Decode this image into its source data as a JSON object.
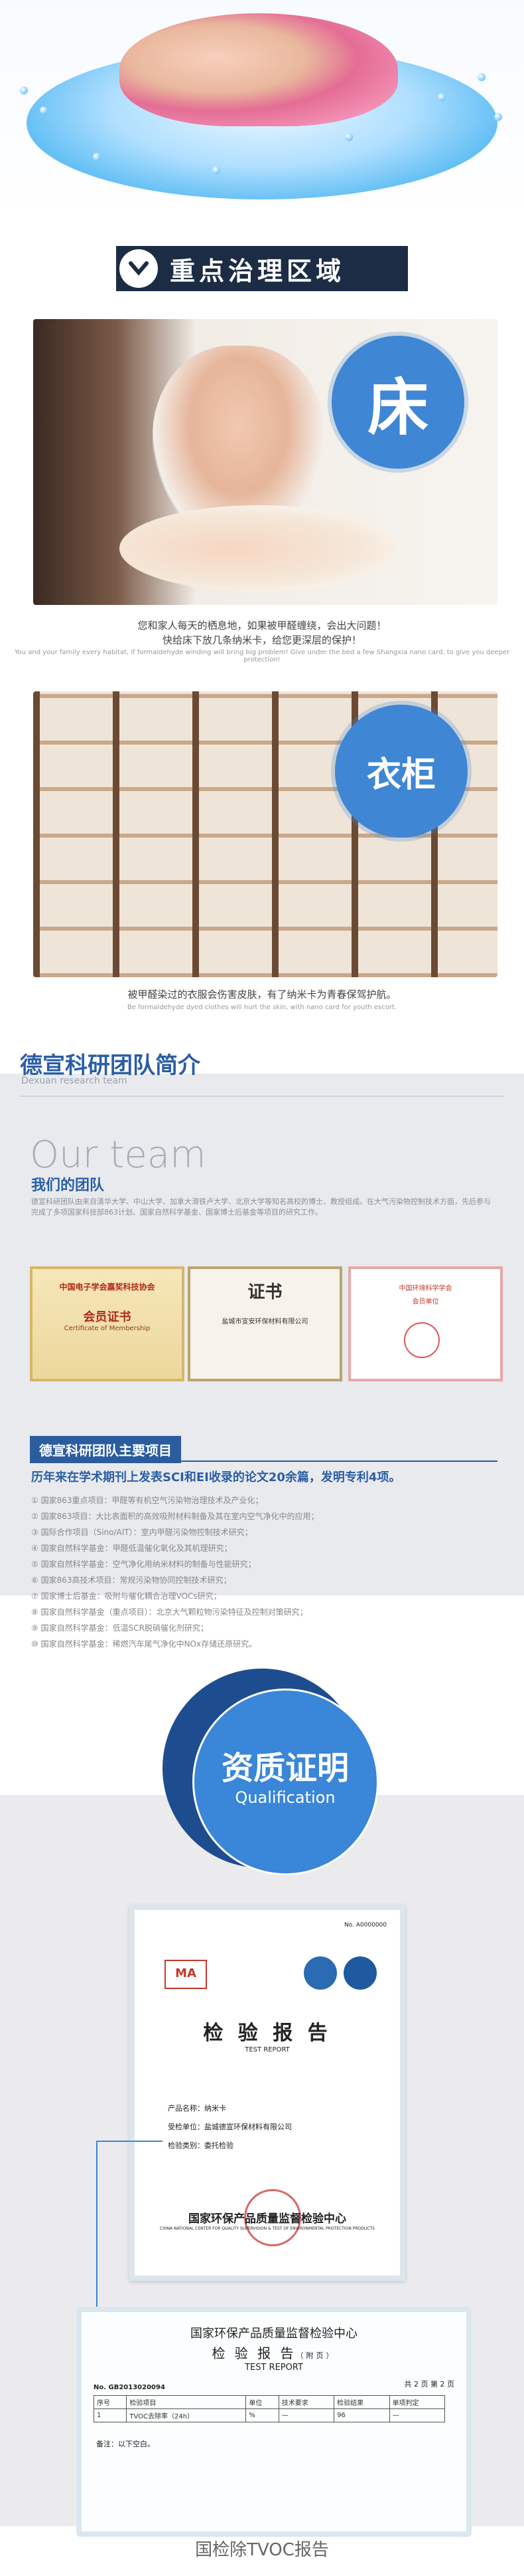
{
  "section_title": "重点治理区域",
  "bed": {
    "badge": "床",
    "caption": "您和家人每天的栖息地，如果被甲醛缠绕，会出大问题！",
    "caption2": "快给床下放几条纳米卡，给您更深层的保护！",
    "caption_en": "You and your family every habitat, if formaldehyde winding will bring big problem! Give under the bed a few Shangxia nano card, to give you deeper protection!"
  },
  "closet": {
    "badge": "衣柜",
    "caption": "被甲醛染过的衣服会伤害皮肤，有了纳米卡为青春保驾护航。",
    "caption_en": "Be formaldehyde dyed clothes will hurt the skin, with nano card for youth escort."
  },
  "team": {
    "heading": "德宣科研团队简介",
    "heading_en": "Dexuan research team",
    "our_team": "Our team",
    "our_team_cn": "我们的团队",
    "intro": "德宣科研团队由来自清华大学、中山大学、加拿大滑铁卢大学、北京大学等知名高校的博士、教授组成。在大气污染物控制技术方面，先后参与完成了多项国家科技部863计划、国家自然科学基金、国家博士后基金等项目的研究工作。",
    "certs": [
      {
        "title": "中国电子学会嘉奖科技协会",
        "sub": "会员证书",
        "en": "Certificate of Membership"
      },
      {
        "title": "证书",
        "sub": "盐城市宣安环保材料有限公司",
        "en": ""
      },
      {
        "title": "中国环境科学学会",
        "sub": "会员单位",
        "en": ""
      }
    ],
    "projects_title": "德宣科研团队主要项目",
    "projects_sub": "历年来在学术期刊上发表SCI和EI收录的论文20余篇，发明专利4项。",
    "projects": [
      "① 国家863重点项目：甲醛等有机空气污染物治理技术及产业化；",
      "② 国家863项目：大比表面积的高效吸附材料制备及其在室内空气净化中的应用；",
      "③ 国际合作项目（Sino/AIT）：室内甲醛污染物控制技术研究；",
      "④ 国家自然科学基金：甲醛低温催化氧化及其机理研究；",
      "⑤ 国家自然科学基金：空气净化用纳米材料的制备与性能研究；",
      "⑥ 国家863高技术项目：常规污染物协同控制技术研究；",
      "⑦ 国家博士后基金：吸附与催化耦合治理VOCs研究；",
      "⑧ 国家自然科学基金（重点项目）：北京大气颗粒物污染特征及控制对策研究；",
      "⑨ 国家自然科学基金：低温SCR脱硝催化剂研究；",
      "⑩ 国家自然科学基金：稀燃汽车尾气净化中NOx存储还原研究。"
    ]
  },
  "qualification": {
    "title": "资质证明",
    "title_en": "Qualification",
    "report1": {
      "number": "No. A0000000",
      "title": "检 验 报 告",
      "title_en": "TEST  REPORT",
      "fields": [
        {
          "label": "产品名称：",
          "value": "纳米卡"
        },
        {
          "label": "受检单位：",
          "value": "盐城德宣环保材料有限公司"
        },
        {
          "label": "检验类别：",
          "value": "委托检验"
        }
      ],
      "footer": "国家环保产品质量监督检验中心",
      "footer_en": "CHINA NATIONAL CENTER FOR QUALITY SUPERVISION & TEST OF ENVIRONMENTAL PROTECTION PRODUCTS"
    },
    "report2": {
      "header": "国家环保产品质量监督检验中心",
      "title": "检 验 报 告",
      "title_note": "（附页）",
      "title_en": "TEST  REPORT",
      "number": "No. GB2013020094",
      "pages": "共 2 页 第 2 页",
      "columns": [
        "序号",
        "检验项目",
        "单位",
        "技术要求",
        "检验结果",
        "单项判定"
      ],
      "row": [
        "1",
        "TVOC去除率（24h）",
        "%",
        "—",
        "96",
        "—"
      ],
      "note": "备注：以下空白。"
    },
    "bottom_caption": "国检除TVOC报告"
  }
}
